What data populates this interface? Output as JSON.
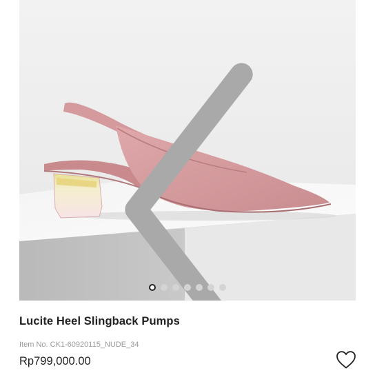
{
  "product": {
    "name": "Lucite Heel Slingback Pumps",
    "item_no": "Item No. CK1-60920115_NUDE_34",
    "price": "Rp799,000.00"
  },
  "gallery": {
    "image_count": 7,
    "active_index": 0,
    "prev_icon": "chevron-left-icon",
    "next_icon": "chevron-right-icon",
    "wishlist_icon": "heart-outline-icon"
  },
  "colors": {
    "shoe": "#d9a1a3",
    "background": "#efefef",
    "accent": "#222222"
  }
}
